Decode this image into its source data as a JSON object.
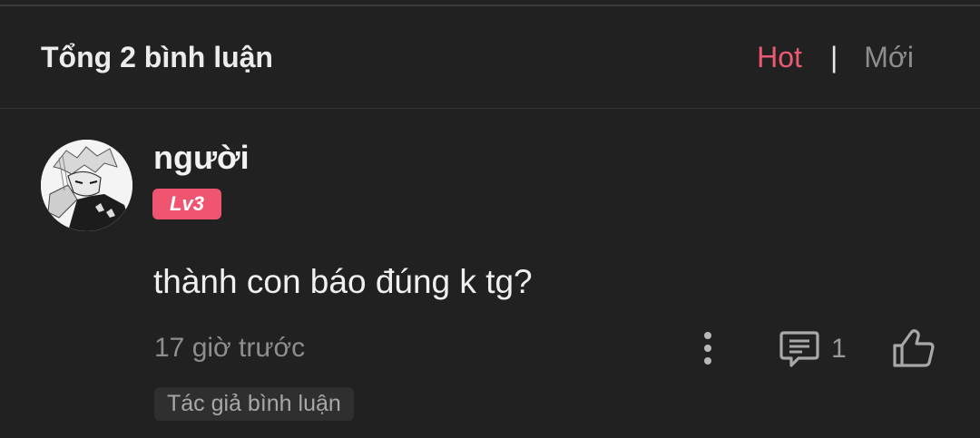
{
  "header": {
    "comment_count_label": "Tổng 2 bình luận",
    "sort_hot": "Hot",
    "sort_separator": "|",
    "sort_new": "Mới",
    "active_sort": "Hot"
  },
  "comment": {
    "username": "người",
    "level_badge": "Lv3",
    "text": "thành con báo đúng k tg?",
    "timestamp": "17 giờ trước",
    "reply_count": "1",
    "author_tag": "Tác giả bình luận"
  },
  "colors": {
    "background": "#212121",
    "accent": "#ec5a72",
    "level_badge": "#ef5470",
    "muted_text": "#8e8e8e"
  },
  "icons": {
    "more": "more-vertical-icon",
    "reply": "comment-icon",
    "like": "thumbs-up-icon"
  }
}
